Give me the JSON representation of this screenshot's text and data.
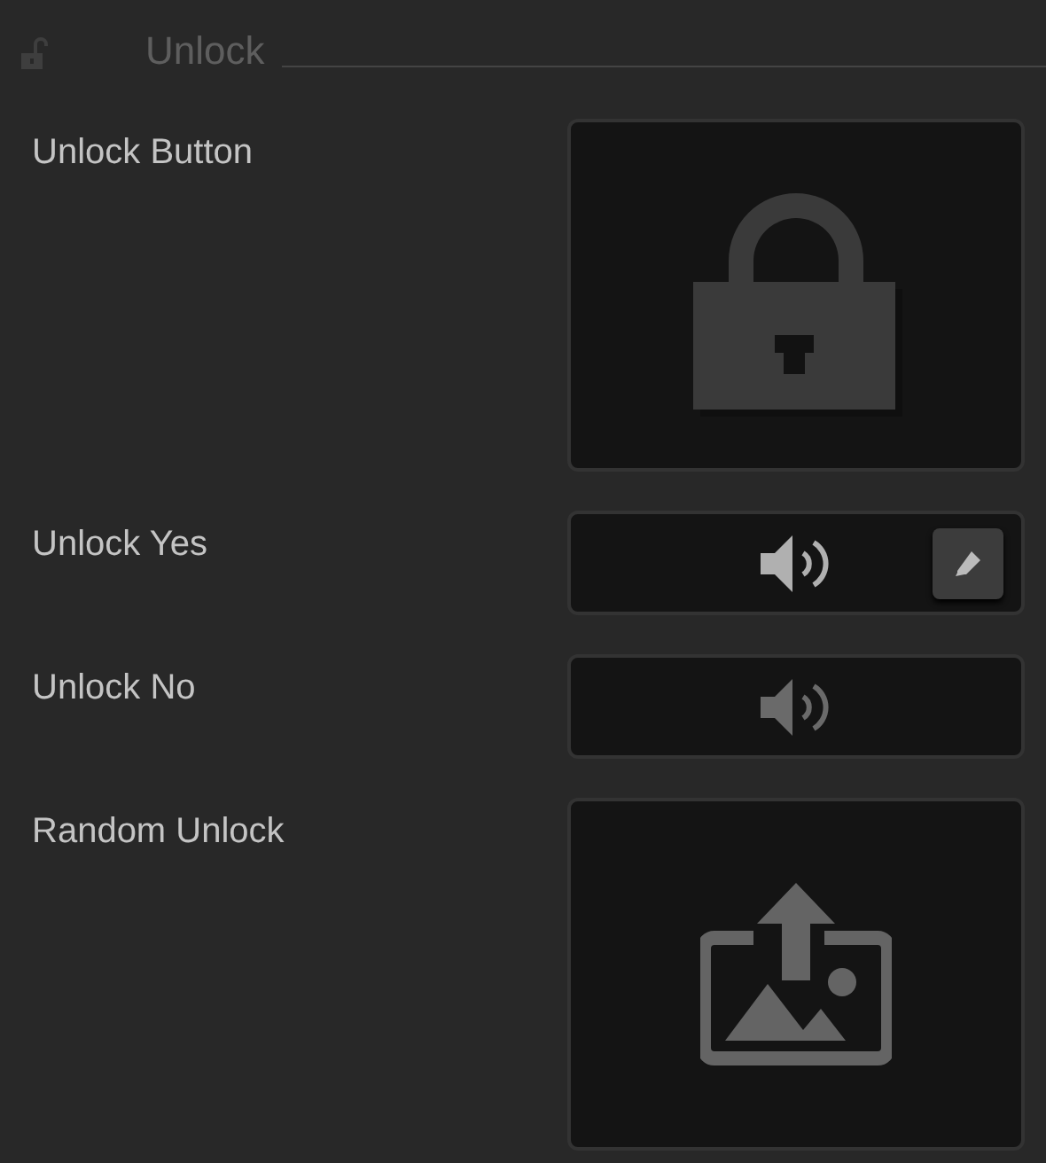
{
  "section": {
    "title": "Unlock"
  },
  "fields": [
    {
      "label": "Unlock Button",
      "kind": "image"
    },
    {
      "label": "Unlock Yes",
      "kind": "sound",
      "assigned": true
    },
    {
      "label": "Unlock No",
      "kind": "sound",
      "assigned": false
    },
    {
      "label": "Random Unlock",
      "kind": "upload"
    }
  ]
}
